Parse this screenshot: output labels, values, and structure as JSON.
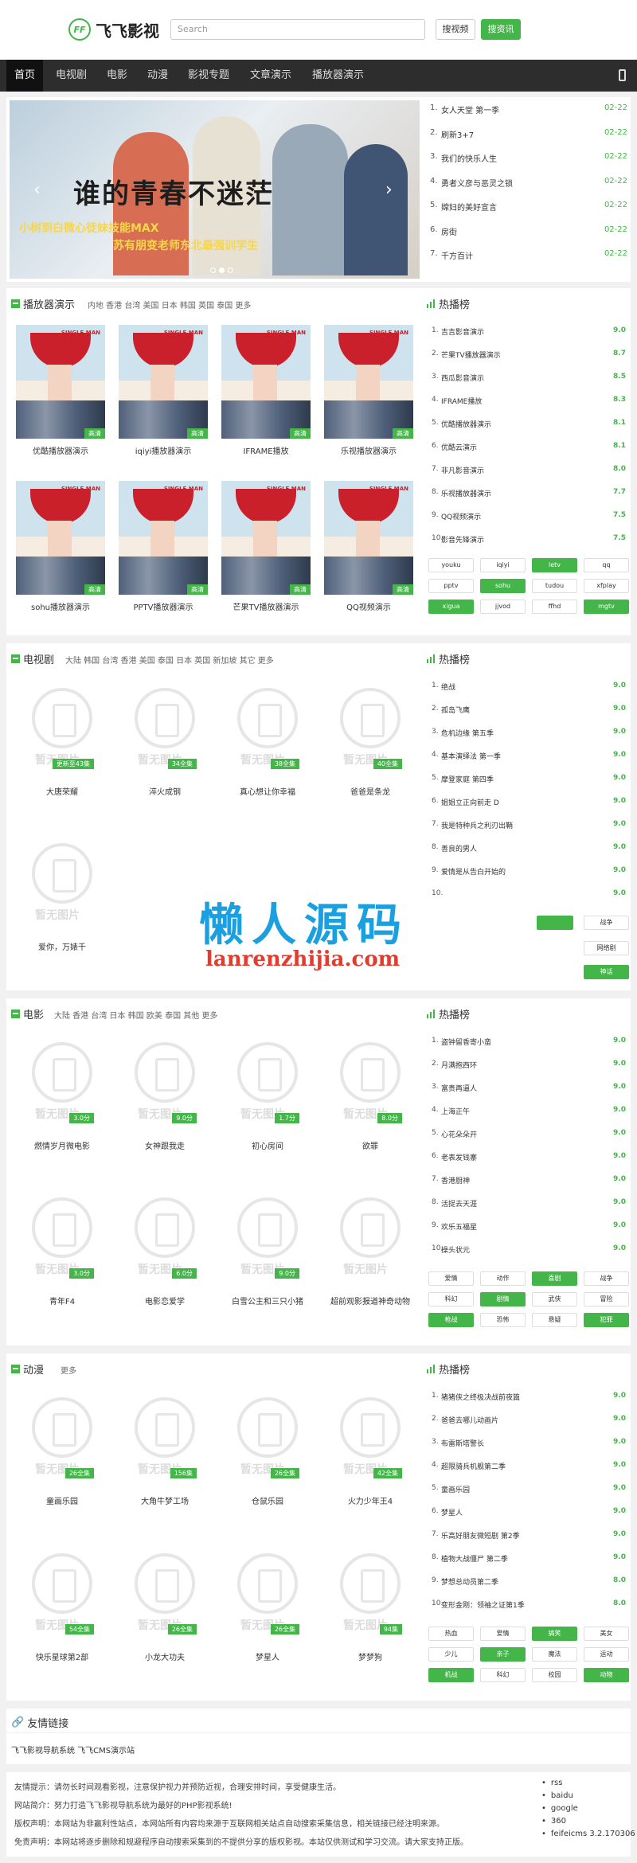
{
  "brand": {
    "logo_badge": "FF",
    "name": "飞飞影视"
  },
  "search": {
    "placeholder": "Search",
    "btn_search": "搜视频",
    "btn_news": "搜资讯"
  },
  "nav": [
    "首页",
    "电视剧",
    "电影",
    "动漫",
    "影视专题",
    "文章演示",
    "播放器演示"
  ],
  "slide": {
    "title": "谁的青春不迷茫",
    "sub1": "小树到白微心徒妹技能MAX",
    "sub2": "苏有朋变老师东北最强训学生"
  },
  "news": [
    {
      "n": "1.",
      "t": "女人天堂 第一季",
      "d": "02-22"
    },
    {
      "n": "2.",
      "t": "刷新3+7",
      "d": "02-22"
    },
    {
      "n": "3.",
      "t": "我们的快乐人生",
      "d": "02-22"
    },
    {
      "n": "4.",
      "t": "勇者义彦与恶灵之锁",
      "d": "02-22"
    },
    {
      "n": "5.",
      "t": "嫦妇的美好宣言",
      "d": "02-22"
    },
    {
      "n": "6.",
      "t": "房街",
      "d": "02-22"
    },
    {
      "n": "7.",
      "t": "千方百计",
      "d": "02-22"
    }
  ],
  "hot_title": "热播榜",
  "s1": {
    "title": "播放器演示",
    "tags": "内地  香港  台湾  美国  日本  韩国  英国  泰国  更多",
    "poster_title": "SINGLE MAN",
    "badge": "高清",
    "items": [
      "优酷播放器演示",
      "iqiyi播放器演示",
      "IFRAME播放",
      "乐视播放器演示",
      "sohu播放器演示",
      "PPTV播放器演示",
      "芒果TV播放器演示",
      "QQ视频演示"
    ],
    "rank": [
      [
        "1.",
        "吉吉影音演示",
        "9.0"
      ],
      [
        "2.",
        "芒果TV播放器演示",
        "8.7"
      ],
      [
        "3.",
        "西瓜影音演示",
        "8.5"
      ],
      [
        "4.",
        "IFRAME播放",
        "8.3"
      ],
      [
        "5.",
        "优酷播放器演示",
        "8.1"
      ],
      [
        "6.",
        "优酷云演示",
        "8.1"
      ],
      [
        "7.",
        "非凡影音演示",
        "8.0"
      ],
      [
        "8.",
        "乐视播放器演示",
        "7.7"
      ],
      [
        "9.",
        "QQ视频演示",
        "7.5"
      ],
      [
        "10.",
        "影音先锋演示",
        "7.5"
      ]
    ],
    "pills": [
      [
        "youku",
        0
      ],
      [
        "iqiyi",
        0
      ],
      [
        "letv",
        1
      ],
      [
        "qq",
        0
      ],
      [
        "pptv",
        0
      ],
      [
        "sohu",
        1
      ],
      [
        "tudou",
        0
      ],
      [
        "xfplay",
        0
      ],
      [
        "xigua",
        1
      ],
      [
        "jjvod",
        0
      ],
      [
        "ffhd",
        0
      ],
      [
        "mgtv",
        1
      ]
    ]
  },
  "s2": {
    "title": "电视剧",
    "tags": "大陆  韩国  台湾  香港  美国  泰国  日本  英国  新加坡  其它  更多",
    "wm": "暂无图片",
    "items": [
      [
        "大唐荣耀",
        "更新至43集"
      ],
      [
        "淬火成钢",
        "34全集"
      ],
      [
        "真心想让你幸福",
        "38全集"
      ],
      [
        "爸爸是条龙",
        "40全集"
      ],
      [
        "爱你，万婊千",
        ""
      ]
    ],
    "rank": [
      [
        "1.",
        "绝战",
        "9.0"
      ],
      [
        "2.",
        "孤岛飞鹰",
        "9.0"
      ],
      [
        "3.",
        "危机边缘 第五季",
        "9.0"
      ],
      [
        "4.",
        "基本演绎法 第一季",
        "9.0"
      ],
      [
        "5.",
        "摩登家庭 第四季",
        "9.0"
      ],
      [
        "6.",
        "姐姐立正向前走 D",
        "9.0"
      ],
      [
        "7.",
        "我是特种兵之利刃出鞘",
        "9.0"
      ],
      [
        "8.",
        "善良的男人",
        "9.0"
      ],
      [
        "9.",
        "爱情是从告白开始的",
        "9.0"
      ],
      [
        "10.",
        "",
        "9.0"
      ]
    ],
    "pills": [
      [
        "战争",
        0
      ],
      [
        "网络剧",
        0
      ],
      [
        "神话",
        1
      ]
    ]
  },
  "watermark": {
    "cn": "懒人源码",
    "url": "lanrenzhijia.com"
  },
  "s3": {
    "title": "电影",
    "tags": "大陆  香港  台湾  日本  韩国  欧美  泰国  其他  更多",
    "items": [
      [
        "燃情岁月微电影",
        "3.0分"
      ],
      [
        "女神跟我走",
        "9.0分"
      ],
      [
        "初心房间",
        "1.7分"
      ],
      [
        "欲罪",
        "8.0分"
      ],
      [
        "青年F4",
        "3.0分"
      ],
      [
        "电影恋爱学",
        "6.0分"
      ],
      [
        "白雪公主和三只小猪",
        "9.0分"
      ],
      [
        "超前观影报道神奇动物",
        ""
      ]
    ],
    "rank": [
      [
        "1.",
        "盗钟留香寄小蛮",
        "9.0"
      ],
      [
        "2.",
        "月满抱西环",
        "9.0"
      ],
      [
        "3.",
        "富贵再逼人",
        "9.0"
      ],
      [
        "4.",
        "上海正午",
        "9.0"
      ],
      [
        "5.",
        "心花朵朵开",
        "9.0"
      ],
      [
        "6.",
        "老表发钱寨",
        "9.0"
      ],
      [
        "7.",
        "香港厨神",
        "9.0"
      ],
      [
        "8.",
        "活捉去天涯",
        "9.0"
      ],
      [
        "9.",
        "欢乐五福星",
        "9.0"
      ],
      [
        "10.",
        "操头状元",
        "9.0"
      ]
    ],
    "pills": [
      [
        "爱情",
        0
      ],
      [
        "动作",
        0
      ],
      [
        "喜剧",
        1
      ],
      [
        "战争",
        0
      ],
      [
        "科幻",
        0
      ],
      [
        "剧情",
        1
      ],
      [
        "武侠",
        0
      ],
      [
        "冒险",
        0
      ],
      [
        "枪战",
        1
      ],
      [
        "恐怖",
        0
      ],
      [
        "悬疑",
        0
      ],
      [
        "犯罪",
        1
      ]
    ]
  },
  "s4": {
    "title": "动漫",
    "tags": "更多",
    "items": [
      [
        "童画乐园",
        "26全集"
      ],
      [
        "大角牛梦工场",
        "156集"
      ],
      [
        "仓鼠乐园",
        "26全集"
      ],
      [
        "火力少年王4",
        "42全集"
      ],
      [
        "快乐星球第2部",
        "54全集"
      ],
      [
        "小龙大功夫",
        "26全集"
      ],
      [
        "梦星人",
        "26全集"
      ],
      [
        "梦梦狗",
        "94集"
      ]
    ],
    "rank": [
      [
        "1.",
        "猪猪侠之终极决战前夜篇",
        "9.0"
      ],
      [
        "2.",
        "爸爸去哪儿动画片",
        "9.0"
      ],
      [
        "3.",
        "布雷斯塔警长",
        "9.0"
      ],
      [
        "4.",
        "超限骑兵机舰第二季",
        "9.0"
      ],
      [
        "5.",
        "童画乐园",
        "9.0"
      ],
      [
        "6.",
        "梦星人",
        "9.0"
      ],
      [
        "7.",
        "乐高好朋友微短剧 第2季",
        "9.0"
      ],
      [
        "8.",
        "植物大战僵尸 第二季",
        "9.0"
      ],
      [
        "9.",
        "梦想总动员第二季",
        "8.0"
      ],
      [
        "10.",
        "变形金刚：领袖之证第1季",
        "8.0"
      ]
    ],
    "pills": [
      [
        "热血",
        0
      ],
      [
        "爱情",
        0
      ],
      [
        "搞笑",
        1
      ],
      [
        "美女",
        0
      ],
      [
        "少儿",
        0
      ],
      [
        "亲子",
        1
      ],
      [
        "魔法",
        0
      ],
      [
        "运动",
        0
      ],
      [
        "机战",
        1
      ],
      [
        "科幻",
        0
      ],
      [
        "校园",
        0
      ],
      [
        "动物",
        1
      ]
    ]
  },
  "links": {
    "title": "友情链接",
    "text": "飞飞影视导航系统  飞飞CMS演示站"
  },
  "footer": {
    "lines": [
      "友情提示：请勿长时间观看影视，注意保护视力并预防近视，合理安排时间，享受健康生活。",
      "网站简介：努力打造飞飞影视导航系统为最好的PHP影视系统!",
      "版权声明：本网站为非赢利性站点，本网站所有内容均来源于互联网相关站点自动搜索采集信息，相关链接已经注明来源。",
      "免责声明：本网站将逐步删除和规避程序自动搜索采集到的不提供分享的版权影视。本站仅供测试和学习交流。请大家支持正版。"
    ],
    "links": [
      "rss",
      "baidu",
      "google",
      "360",
      "feifeicms 3.2.170306"
    ]
  }
}
